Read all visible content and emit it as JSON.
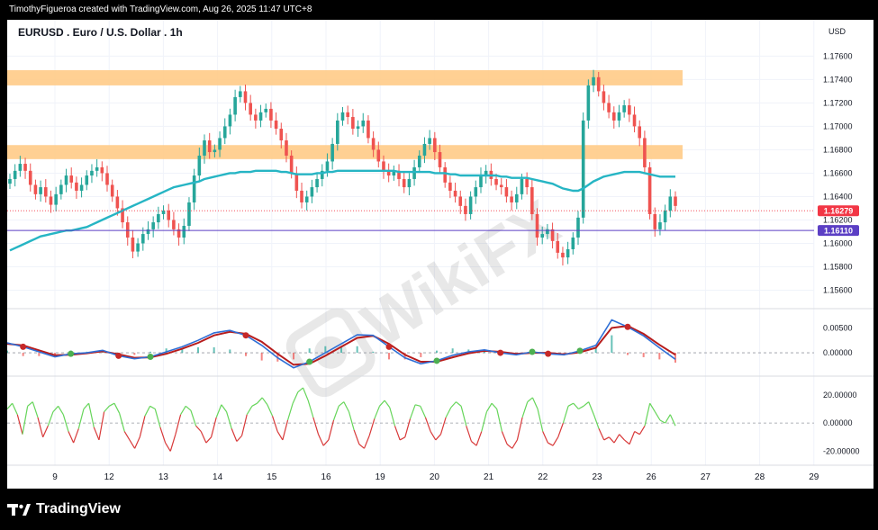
{
  "header": {
    "credit": "TimothyFigueroa created with TradingView.com, Aug 26, 2025 11:47 UTC+8"
  },
  "footer": {
    "brand": "TradingView"
  },
  "watermark": {
    "text": "WikiFX"
  },
  "colors": {
    "up": "#26a69a",
    "down": "#ef5350",
    "ma": "#26b5c4",
    "zone": "#ffc880",
    "price_label": "#f23645",
    "level_label": "#5b3fc4",
    "macd_fast": "#2f6fd6",
    "macd_slow": "#b71c1c",
    "cross_green": "#4caf50",
    "cross_red": "#c62828",
    "osc_pos": "#66d55a",
    "osc_neg": "#d83a3a"
  },
  "chart_data": [
    {
      "type": "line",
      "title": "EURUSD . Euro / U.S. Dollar . 1h",
      "currency": "USD",
      "ylim": [
        1.1545,
        1.1768
      ],
      "y_ticks": [
        "1.17600",
        "1.17400",
        "1.17200",
        "1.17000",
        "1.16800",
        "1.16600",
        "1.16400",
        "1.16200",
        "1.16000",
        "1.15800",
        "1.15600"
      ],
      "x_ticks": [
        "9",
        "12",
        "13",
        "14",
        "15",
        "16",
        "19",
        "20",
        "21",
        "22",
        "23",
        "26",
        "27",
        "28",
        "29"
      ],
      "resistance_zones": [
        [
          1.1735,
          1.1748
        ],
        [
          1.1672,
          1.1684
        ]
      ],
      "horizontal_line": 1.1611,
      "current_price": 1.16279,
      "price_labels": [
        "1.16279",
        "1.16110"
      ],
      "series": [
        {
          "values": [
            1.1655,
            1.1662,
            1.1668,
            1.1662,
            1.165,
            1.1642,
            1.1648,
            1.164,
            1.1633,
            1.1642,
            1.165,
            1.1658,
            1.1652,
            1.1645,
            1.165,
            1.1658,
            1.1662,
            1.1665,
            1.166,
            1.165,
            1.164,
            1.163,
            1.1618,
            1.1605,
            1.1593,
            1.16,
            1.1608,
            1.1612,
            1.1618,
            1.1625,
            1.1628,
            1.162,
            1.1612,
            1.1605,
            1.1615,
            1.1635,
            1.1658,
            1.1675,
            1.1688,
            1.1678,
            1.168,
            1.169,
            1.17,
            1.171,
            1.1725,
            1.173,
            1.172,
            1.171,
            1.1705,
            1.1712,
            1.1715,
            1.1705,
            1.1698,
            1.1688,
            1.1675,
            1.166,
            1.1645,
            1.1635,
            1.164,
            1.1648,
            1.1655,
            1.1662,
            1.167,
            1.1685,
            1.1705,
            1.1712,
            1.1708,
            1.1698,
            1.17,
            1.1705,
            1.169,
            1.168,
            1.167,
            1.1662,
            1.1658,
            1.1662,
            1.1655,
            1.1648,
            1.1655,
            1.1665,
            1.1675,
            1.1685,
            1.169,
            1.1678,
            1.1665,
            1.1652,
            1.1645,
            1.164,
            1.1632,
            1.1625,
            1.164,
            1.1648,
            1.1658,
            1.1662,
            1.1655,
            1.165,
            1.1648,
            1.164,
            1.1635,
            1.1642,
            1.1655,
            1.1648,
            1.1625,
            1.1605,
            1.1608,
            1.1612,
            1.1602,
            1.1592,
            1.1588,
            1.1595,
            1.1605,
            1.1622,
            1.1705,
            1.1735,
            1.1742,
            1.173,
            1.172,
            1.1712,
            1.1705,
            1.1712,
            1.1718,
            1.171,
            1.17,
            1.169,
            1.1665,
            1.1625,
            1.1612,
            1.1618,
            1.1628,
            1.164,
            1.1632
          ],
          "ma200": [
            1.1594,
            1.1596,
            1.1598,
            1.16,
            1.1602,
            1.1604,
            1.1606,
            1.1607,
            1.1608,
            1.1609,
            1.161,
            1.1611,
            1.1611,
            1.1612,
            1.1613,
            1.1614,
            1.1616,
            1.1618,
            1.162,
            1.1622,
            1.1624,
            1.1626,
            1.1628,
            1.163,
            1.1632,
            1.1634,
            1.1636,
            1.1638,
            1.164,
            1.1642,
            1.1644,
            1.1646,
            1.1648,
            1.1649,
            1.165,
            1.1651,
            1.1652,
            1.1653,
            1.1655,
            1.1656,
            1.1657,
            1.1658,
            1.1659,
            1.166,
            1.166,
            1.1661,
            1.1661,
            1.1661,
            1.1662,
            1.1662,
            1.1662,
            1.1662,
            1.1662,
            1.1661,
            1.1661,
            1.166,
            1.1659,
            1.1659,
            1.1659,
            1.1659,
            1.166,
            1.166,
            1.1661,
            1.1661,
            1.1662,
            1.1662,
            1.1662,
            1.1662,
            1.1662,
            1.1662,
            1.1662,
            1.1662,
            1.1662,
            1.1662,
            1.1662,
            1.1662,
            1.1661,
            1.1661,
            1.1661,
            1.1661,
            1.1661,
            1.1661,
            1.1661,
            1.166,
            1.166,
            1.166,
            1.1659,
            1.1659,
            1.1658,
            1.1658,
            1.1658,
            1.1658,
            1.1658,
            1.1658,
            1.1658,
            1.1658,
            1.1657,
            1.1657,
            1.1656,
            1.1656,
            1.1656,
            1.1656,
            1.1655,
            1.1654,
            1.1653,
            1.1652,
            1.1651,
            1.1649,
            1.1647,
            1.1646,
            1.1645,
            1.1645,
            1.1647,
            1.165,
            1.1653,
            1.1655,
            1.1657,
            1.1658,
            1.1659,
            1.166,
            1.1661,
            1.1661,
            1.1661,
            1.1661,
            1.166,
            1.1659,
            1.1658,
            1.1657,
            1.1657,
            1.1657,
            1.1657
          ]
        }
      ]
    },
    {
      "type": "line",
      "ylim": [
        -0.0045,
        0.0085
      ],
      "y_ticks": [
        "0.00500",
        "0.00000"
      ],
      "series": [
        {
          "values": [
            0.002,
            0.0012,
            0.0002,
            -0.0008,
            -0.0002,
            0.0,
            0.0005,
            -0.0006,
            -0.0012,
            -0.0008,
            0.0002,
            0.0012,
            0.0025,
            0.004,
            0.0045,
            0.0035,
            0.0015,
            -0.001,
            -0.003,
            -0.0018,
            0.0,
            0.0018,
            0.0036,
            0.0035,
            0.0012,
            -0.001,
            -0.0022,
            -0.0016,
            -0.0005,
            0.0002,
            0.0006,
            0.0,
            -0.0004,
            0.0002,
            -0.0002,
            -0.0004,
            0.0004,
            0.0015,
            0.0066,
            0.0052,
            0.0034,
            0.001,
            -0.0013
          ]
        },
        {
          "values": [
            0.0018,
            0.0015,
            0.0005,
            -0.0005,
            -0.0004,
            -0.0001,
            0.0003,
            -0.0003,
            -0.001,
            -0.0009,
            -0.0002,
            0.0008,
            0.002,
            0.0035,
            0.0042,
            0.0038,
            0.0022,
            -0.0002,
            -0.0024,
            -0.0022,
            -0.0006,
            0.0012,
            0.003,
            0.0034,
            0.0018,
            -0.0004,
            -0.0018,
            -0.0018,
            -0.0009,
            -0.0001,
            0.0004,
            0.0002,
            -0.0002,
            0.0,
            0.0,
            -0.0003,
            0.0001,
            0.001,
            0.005,
            0.0054,
            0.0038,
            0.0016,
            -0.0004
          ]
        }
      ]
    },
    {
      "type": "line",
      "ylim": [
        -28,
        32
      ],
      "y_ticks": [
        "20.00000",
        "0.00000",
        "-20.00000"
      ],
      "series": [
        {
          "values": [
            10,
            14,
            6,
            -8,
            12,
            15,
            4,
            -10,
            -2,
            8,
            12,
            6,
            -6,
            -14,
            -4,
            10,
            14,
            -3,
            -12,
            8,
            12,
            14,
            7,
            -6,
            -12,
            -18,
            -10,
            5,
            12,
            10,
            -3,
            -14,
            -20,
            -8,
            6,
            12,
            9,
            -2,
            -6,
            -14,
            -10,
            4,
            13,
            8,
            -4,
            -13,
            -9,
            6,
            12,
            14,
            18,
            13,
            5,
            -6,
            -12,
            2,
            14,
            22,
            25,
            16,
            4,
            -8,
            -16,
            -12,
            2,
            12,
            15,
            8,
            -5,
            -15,
            -18,
            -9,
            3,
            12,
            16,
            11,
            -2,
            -12,
            -10,
            3,
            13,
            12,
            4,
            -6,
            -12,
            -8,
            4,
            11,
            15,
            12,
            -2,
            -13,
            -16,
            -6,
            8,
            14,
            10,
            -6,
            -15,
            -18,
            -12,
            4,
            15,
            18,
            10,
            -6,
            -14,
            -16,
            -10,
            0,
            12,
            14,
            10,
            12,
            15,
            6,
            -4,
            -12,
            -10,
            -14,
            -8,
            -12,
            -15,
            -6,
            -8,
            -2,
            14,
            8,
            2,
            0,
            6,
            -2
          ]
        }
      ]
    }
  ]
}
